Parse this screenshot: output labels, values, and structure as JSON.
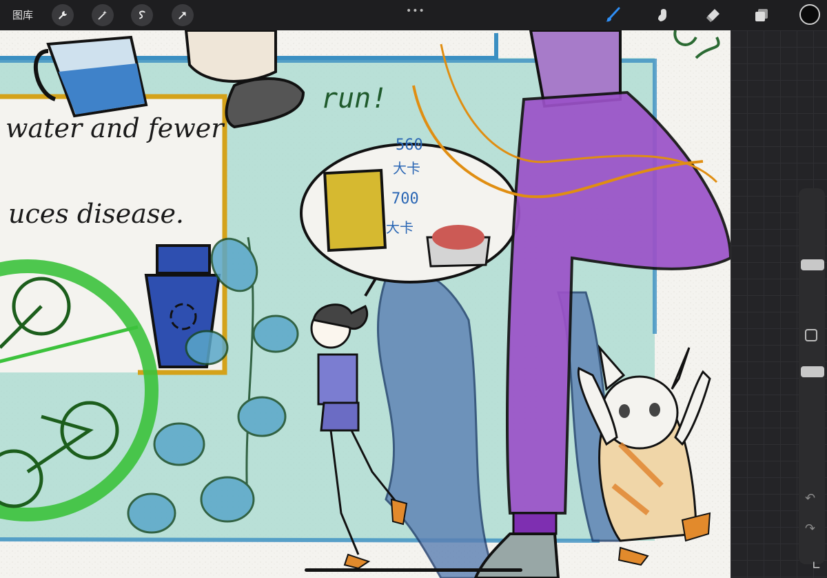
{
  "toolbar": {
    "gallery_label": "图库",
    "left_tools": [
      "wrench-icon",
      "magic-wand-icon",
      "selection-s-icon",
      "transform-arrow-icon"
    ],
    "more_label": "•••",
    "right_tools": [
      "brush-icon",
      "smudge-icon",
      "eraser-icon",
      "layers-icon"
    ],
    "active_tool": "brush",
    "accent_color": "#2f8ef4",
    "current_color": "#0a0a0a"
  },
  "canvas": {
    "caption_line1": "water and fewer",
    "caption_line2": "uces disease.",
    "speech_label": "run!",
    "calorie_top": "560",
    "calorie_top_unit": "大卡",
    "calorie_bottom": "700",
    "calorie_bottom_unit": "大卡"
  },
  "sidebar": {
    "brush_size_level": 0.45,
    "opacity_level": 0.3
  },
  "colors": {
    "paper": "#f4f3ef",
    "teal_wash": "#8fcfc5",
    "blue_frame": "#3b8fc2",
    "gold_frame": "#d4a21a",
    "purple": "#9b52c8",
    "green_ring": "#3cc23c"
  }
}
